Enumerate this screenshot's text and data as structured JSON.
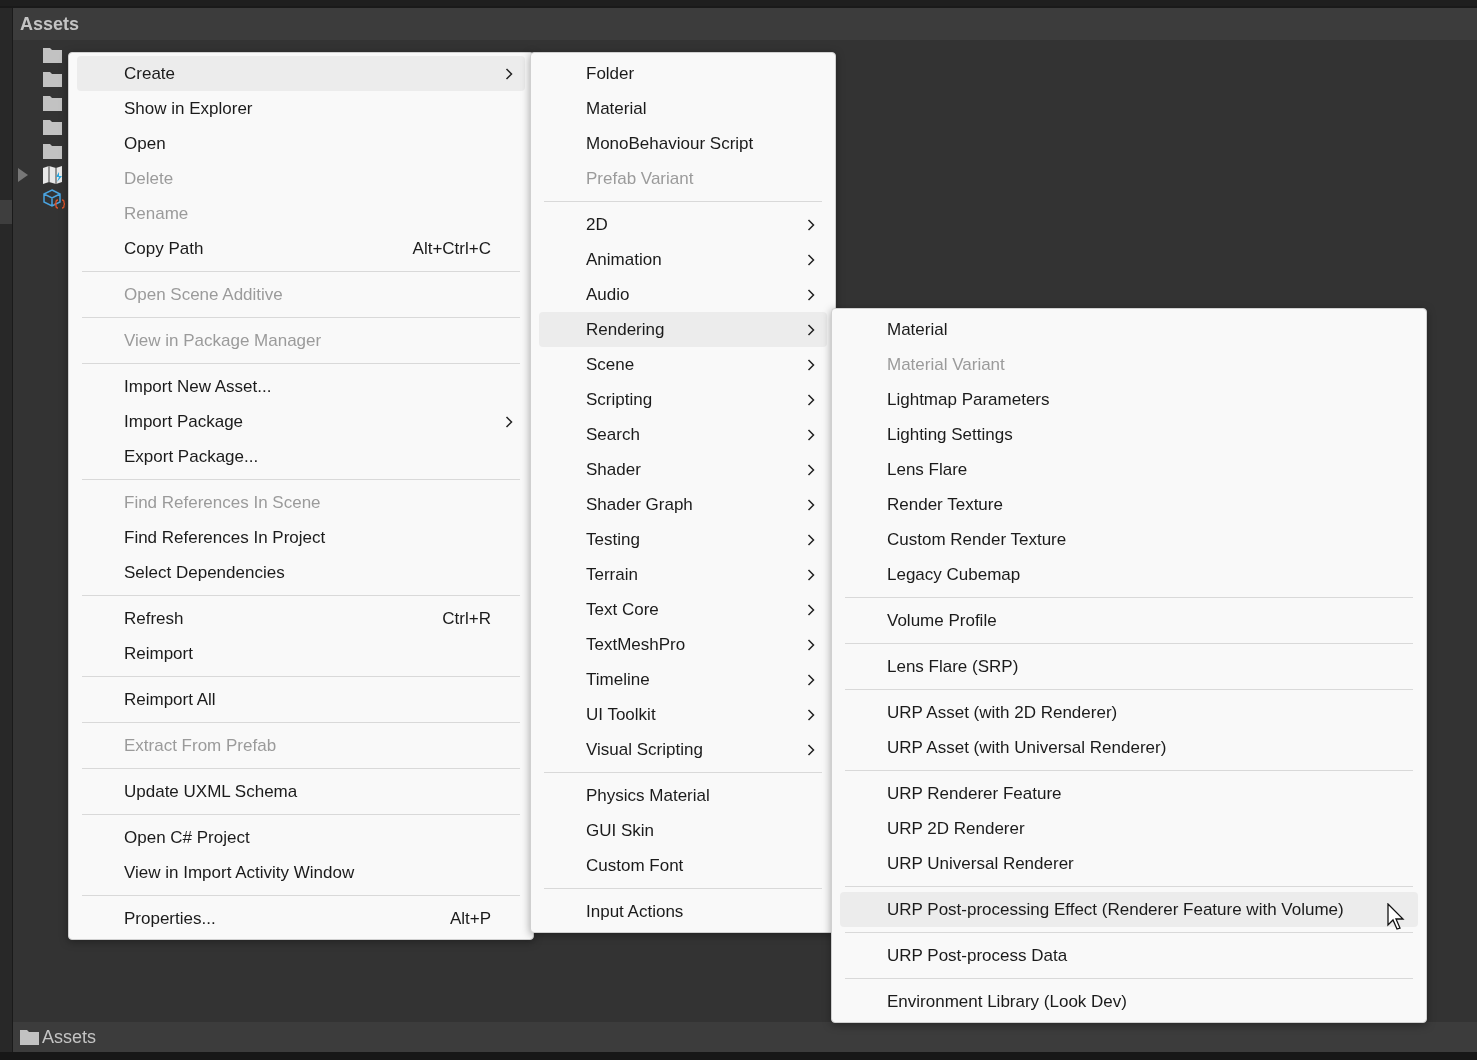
{
  "panel": {
    "title": "Assets",
    "tree": [
      {
        "kind": "folder"
      },
      {
        "kind": "folder"
      },
      {
        "kind": "folder"
      },
      {
        "kind": "folder"
      },
      {
        "kind": "folder"
      },
      {
        "kind": "scene",
        "expanded": false
      },
      {
        "kind": "script"
      }
    ],
    "breadcrumb": "Assets"
  },
  "menus": [
    {
      "items": [
        {
          "kind": "item",
          "label": "Create",
          "submenu": true,
          "disabled": false,
          "selected": true
        },
        {
          "kind": "item",
          "label": "Show in Explorer",
          "disabled": false,
          "selected": false
        },
        {
          "kind": "item",
          "label": "Open",
          "disabled": false,
          "selected": false
        },
        {
          "kind": "item",
          "label": "Delete",
          "disabled": true,
          "selected": false
        },
        {
          "kind": "item",
          "label": "Rename",
          "disabled": true,
          "selected": false
        },
        {
          "kind": "item",
          "label": "Copy Path",
          "shortcut": "Alt+Ctrl+C",
          "disabled": false,
          "selected": false
        },
        {
          "kind": "separator"
        },
        {
          "kind": "item",
          "label": "Open Scene Additive",
          "disabled": true,
          "selected": false
        },
        {
          "kind": "separator"
        },
        {
          "kind": "item",
          "label": "View in Package Manager",
          "disabled": true,
          "selected": false
        },
        {
          "kind": "separator"
        },
        {
          "kind": "item",
          "label": "Import New Asset...",
          "disabled": false,
          "selected": false
        },
        {
          "kind": "item",
          "label": "Import Package",
          "submenu": true,
          "disabled": false,
          "selected": false
        },
        {
          "kind": "item",
          "label": "Export Package...",
          "disabled": false,
          "selected": false
        },
        {
          "kind": "separator"
        },
        {
          "kind": "item",
          "label": "Find References In Scene",
          "disabled": true,
          "selected": false
        },
        {
          "kind": "item",
          "label": "Find References In Project",
          "disabled": false,
          "selected": false
        },
        {
          "kind": "item",
          "label": "Select Dependencies",
          "disabled": false,
          "selected": false
        },
        {
          "kind": "separator"
        },
        {
          "kind": "item",
          "label": "Refresh",
          "shortcut": "Ctrl+R",
          "disabled": false,
          "selected": false
        },
        {
          "kind": "item",
          "label": "Reimport",
          "disabled": false,
          "selected": false
        },
        {
          "kind": "separator"
        },
        {
          "kind": "item",
          "label": "Reimport All",
          "disabled": false,
          "selected": false
        },
        {
          "kind": "separator"
        },
        {
          "kind": "item",
          "label": "Extract From Prefab",
          "disabled": true,
          "selected": false
        },
        {
          "kind": "separator"
        },
        {
          "kind": "item",
          "label": "Update UXML Schema",
          "disabled": false,
          "selected": false
        },
        {
          "kind": "separator"
        },
        {
          "kind": "item",
          "label": "Open C# Project",
          "disabled": false,
          "selected": false
        },
        {
          "kind": "item",
          "label": "View in Import Activity Window",
          "disabled": false,
          "selected": false
        },
        {
          "kind": "separator"
        },
        {
          "kind": "item",
          "label": "Properties...",
          "shortcut": "Alt+P",
          "disabled": false,
          "selected": false
        }
      ]
    },
    {
      "items": [
        {
          "kind": "item",
          "label": "Folder",
          "disabled": false,
          "selected": false
        },
        {
          "kind": "item",
          "label": "Material",
          "disabled": false,
          "selected": false
        },
        {
          "kind": "item",
          "label": "MonoBehaviour Script",
          "disabled": false,
          "selected": false
        },
        {
          "kind": "item",
          "label": "Prefab Variant",
          "disabled": true,
          "selected": false
        },
        {
          "kind": "separator"
        },
        {
          "kind": "item",
          "label": "2D",
          "submenu": true,
          "disabled": false,
          "selected": false
        },
        {
          "kind": "item",
          "label": "Animation",
          "submenu": true,
          "disabled": false,
          "selected": false
        },
        {
          "kind": "item",
          "label": "Audio",
          "submenu": true,
          "disabled": false,
          "selected": false
        },
        {
          "kind": "item",
          "label": "Rendering",
          "submenu": true,
          "disabled": false,
          "selected": true
        },
        {
          "kind": "item",
          "label": "Scene",
          "submenu": true,
          "disabled": false,
          "selected": false
        },
        {
          "kind": "item",
          "label": "Scripting",
          "submenu": true,
          "disabled": false,
          "selected": false
        },
        {
          "kind": "item",
          "label": "Search",
          "submenu": true,
          "disabled": false,
          "selected": false
        },
        {
          "kind": "item",
          "label": "Shader",
          "submenu": true,
          "disabled": false,
          "selected": false
        },
        {
          "kind": "item",
          "label": "Shader Graph",
          "submenu": true,
          "disabled": false,
          "selected": false
        },
        {
          "kind": "item",
          "label": "Testing",
          "submenu": true,
          "disabled": false,
          "selected": false
        },
        {
          "kind": "item",
          "label": "Terrain",
          "submenu": true,
          "disabled": false,
          "selected": false
        },
        {
          "kind": "item",
          "label": "Text Core",
          "submenu": true,
          "disabled": false,
          "selected": false
        },
        {
          "kind": "item",
          "label": "TextMeshPro",
          "submenu": true,
          "disabled": false,
          "selected": false
        },
        {
          "kind": "item",
          "label": "Timeline",
          "submenu": true,
          "disabled": false,
          "selected": false
        },
        {
          "kind": "item",
          "label": "UI Toolkit",
          "submenu": true,
          "disabled": false,
          "selected": false
        },
        {
          "kind": "item",
          "label": "Visual Scripting",
          "submenu": true,
          "disabled": false,
          "selected": false
        },
        {
          "kind": "separator"
        },
        {
          "kind": "item",
          "label": "Physics Material",
          "disabled": false,
          "selected": false
        },
        {
          "kind": "item",
          "label": "GUI Skin",
          "disabled": false,
          "selected": false
        },
        {
          "kind": "item",
          "label": "Custom Font",
          "disabled": false,
          "selected": false
        },
        {
          "kind": "separator"
        },
        {
          "kind": "item",
          "label": "Input Actions",
          "disabled": false,
          "selected": false
        }
      ]
    },
    {
      "items": [
        {
          "kind": "item",
          "label": "Material",
          "disabled": false,
          "selected": false
        },
        {
          "kind": "item",
          "label": "Material Variant",
          "disabled": true,
          "selected": false
        },
        {
          "kind": "item",
          "label": "Lightmap Parameters",
          "disabled": false,
          "selected": false
        },
        {
          "kind": "item",
          "label": "Lighting Settings",
          "disabled": false,
          "selected": false
        },
        {
          "kind": "item",
          "label": "Lens Flare",
          "disabled": false,
          "selected": false
        },
        {
          "kind": "item",
          "label": "Render Texture",
          "disabled": false,
          "selected": false
        },
        {
          "kind": "item",
          "label": "Custom Render Texture",
          "disabled": false,
          "selected": false
        },
        {
          "kind": "item",
          "label": "Legacy Cubemap",
          "disabled": false,
          "selected": false
        },
        {
          "kind": "separator"
        },
        {
          "kind": "item",
          "label": "Volume Profile",
          "disabled": false,
          "selected": false
        },
        {
          "kind": "separator"
        },
        {
          "kind": "item",
          "label": "Lens Flare (SRP)",
          "disabled": false,
          "selected": false
        },
        {
          "kind": "separator"
        },
        {
          "kind": "item",
          "label": "URP Asset (with 2D Renderer)",
          "disabled": false,
          "selected": false
        },
        {
          "kind": "item",
          "label": "URP Asset (with Universal Renderer)",
          "disabled": false,
          "selected": false
        },
        {
          "kind": "separator"
        },
        {
          "kind": "item",
          "label": "URP Renderer Feature",
          "disabled": false,
          "selected": false
        },
        {
          "kind": "item",
          "label": "URP 2D Renderer",
          "disabled": false,
          "selected": false
        },
        {
          "kind": "item",
          "label": "URP Universal Renderer",
          "disabled": false,
          "selected": false
        },
        {
          "kind": "separator"
        },
        {
          "kind": "item",
          "label": "URP Post-processing Effect (Renderer Feature with Volume)",
          "disabled": false,
          "selected": true
        },
        {
          "kind": "separator"
        },
        {
          "kind": "item",
          "label": "URP Post-process Data",
          "disabled": false,
          "selected": false
        },
        {
          "kind": "separator"
        },
        {
          "kind": "item",
          "label": "Environment Library (Look Dev)",
          "disabled": false,
          "selected": false
        }
      ]
    }
  ]
}
